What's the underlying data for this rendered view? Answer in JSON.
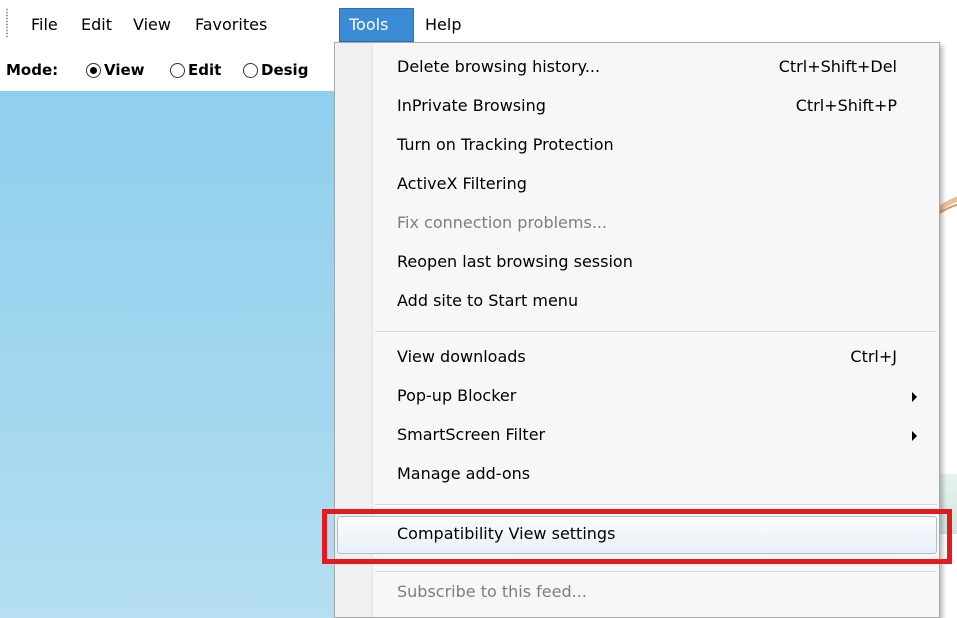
{
  "menubar": {
    "items": [
      "File",
      "Edit",
      "View",
      "Favorites",
      "Tools",
      "Help"
    ],
    "active_index": 4
  },
  "modebar": {
    "label": "Mode:",
    "options": [
      {
        "label": "View",
        "checked": true
      },
      {
        "label": "Edit",
        "checked": false
      },
      {
        "label": "Desig",
        "checked": false
      }
    ]
  },
  "tools_menu": {
    "items": [
      {
        "label": "Delete browsing history...",
        "shortcut": "Ctrl+Shift+Del",
        "submenu": false,
        "disabled": false
      },
      {
        "label": "InPrivate Browsing",
        "shortcut": "Ctrl+Shift+P",
        "submenu": false,
        "disabled": false
      },
      {
        "label": "Turn on Tracking Protection",
        "shortcut": "",
        "submenu": false,
        "disabled": false
      },
      {
        "label": "ActiveX Filtering",
        "shortcut": "",
        "submenu": false,
        "disabled": false
      },
      {
        "label": "Fix connection problems...",
        "shortcut": "",
        "submenu": false,
        "disabled": true
      },
      {
        "label": "Reopen last browsing session",
        "shortcut": "",
        "submenu": false,
        "disabled": false
      },
      {
        "label": "Add site to Start menu",
        "shortcut": "",
        "submenu": false,
        "disabled": false
      },
      {
        "label": "View downloads",
        "shortcut": "Ctrl+J",
        "submenu": false,
        "disabled": false
      },
      {
        "label": "Pop-up Blocker",
        "shortcut": "",
        "submenu": true,
        "disabled": false
      },
      {
        "label": "SmartScreen Filter",
        "shortcut": "",
        "submenu": true,
        "disabled": false
      },
      {
        "label": "Manage add-ons",
        "shortcut": "",
        "submenu": false,
        "disabled": false
      },
      {
        "label": "Compatibility View settings",
        "shortcut": "",
        "submenu": false,
        "disabled": false,
        "hovered": true
      },
      {
        "label": "Subscribe to this feed...",
        "shortcut": "",
        "submenu": false,
        "disabled": true
      }
    ]
  },
  "annotation": {
    "highlight_color": "#e21b22",
    "highlighted_item": "Compatibility View settings"
  },
  "colors": {
    "menu_active_bg": "#3a8ad6",
    "page_bg": "#8fcfee",
    "disabled_text": "#7e7e7e"
  },
  "icons": {
    "submenu_arrow": "chevron-right-icon"
  }
}
